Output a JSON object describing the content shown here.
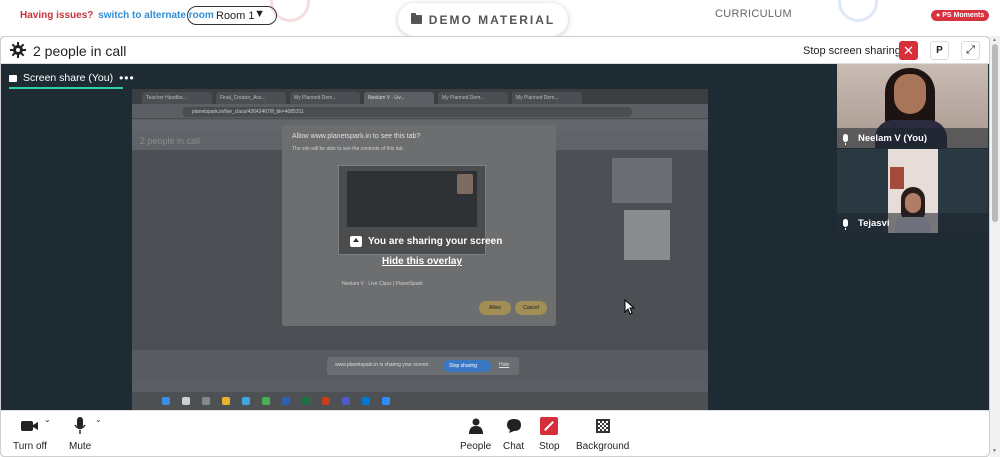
{
  "topbar": {
    "issue_text": "Having issues?",
    "alternate_link": "switch to alternate room",
    "room_select": "Room 1",
    "demo_material": "DEMO MATERIAL",
    "curriculum": "CURRICULUM",
    "ps_moments": "PS Moments"
  },
  "call": {
    "people_count": "2 people in call",
    "stop_screen_sharing": "Stop screen sharing",
    "p_button": "P",
    "share_tab": "Screen share (You)"
  },
  "shared_screen": {
    "address": "planetspark.in/live_class/42642467/fl_bk=4085311",
    "tabs": [
      "Teacher Handbo...",
      "Final_Creator_Ass...",
      "My Planned Dem...",
      "Neelam V · Liv...",
      "My Planned Dem...",
      "My Planned Dem..."
    ],
    "inner_people": "2 people in call",
    "dialog_title": "Allow www.planetspark.in to see this tab?",
    "dialog_sub": "The site will be able to see the contents of this tab.",
    "dialog_tab_label": "Neelam V · Live Class | PlanetSpark",
    "dialog_allow": "Allow",
    "dialog_cancel": "Cancel",
    "share_notice": "www.planetspark.in is sharing your screen.",
    "share_stop": "Stop sharing",
    "share_hide": "Hide"
  },
  "overlay": {
    "title": "You are sharing your screen",
    "hide_link": "Hide this overlay"
  },
  "participants": [
    {
      "name": "Neelam V (You)"
    },
    {
      "name": "Tejasvi"
    }
  ],
  "toolbar": {
    "camera": "Turn off",
    "mute": "Mute",
    "people": "People",
    "chat": "Chat",
    "stop": "Stop",
    "background": "Background"
  },
  "colors": {
    "danger": "#d62f3a",
    "share_underline": "#2bd3a6",
    "call_bg": "#1f2b33"
  }
}
